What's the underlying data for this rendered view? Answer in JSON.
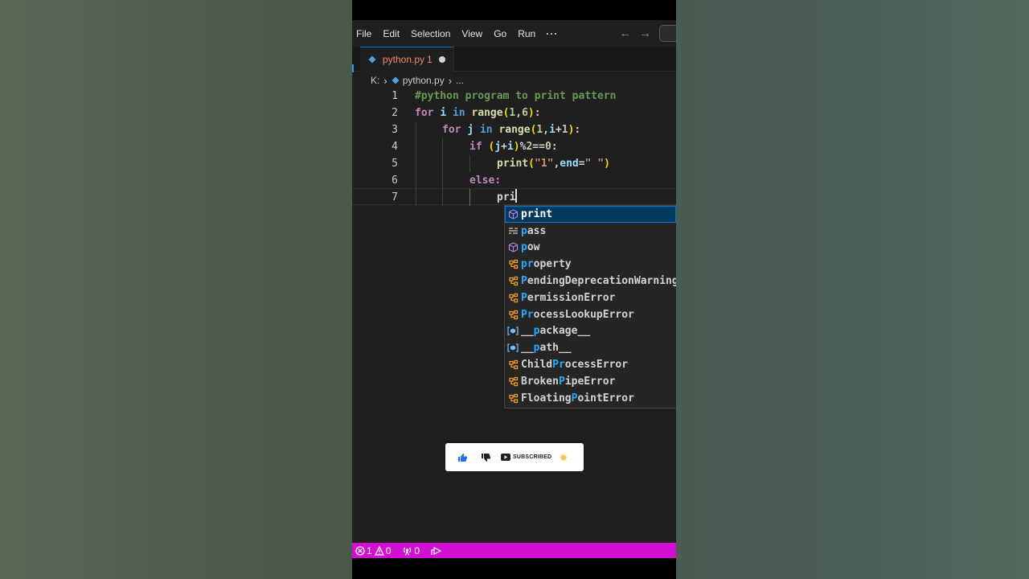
{
  "menubar": {
    "items": [
      "File",
      "Edit",
      "Selection",
      "View",
      "Go",
      "Run"
    ],
    "more": "···",
    "back_icon": "arrow-left-icon",
    "forward_icon": "arrow-right-icon"
  },
  "tab": {
    "filename": "python.py",
    "problem_count": "1",
    "modified": true
  },
  "breadcrumb": {
    "drive": "K:",
    "file": "python.py",
    "more": "..."
  },
  "editor": {
    "lines": [
      {
        "num": "1",
        "text": "#python program to print pattern"
      },
      {
        "num": "2",
        "text": "for i in range(1,6):"
      },
      {
        "num": "3",
        "text": "for j in range(1,i+1):"
      },
      {
        "num": "4",
        "text": "if (j+i)%2==0:"
      },
      {
        "num": "5",
        "text": "print(\"1\",end=\" \")"
      },
      {
        "num": "6",
        "text": "else:"
      },
      {
        "num": "7",
        "text": "pri"
      }
    ],
    "current_line": "7"
  },
  "suggestions": [
    {
      "label": "print",
      "icon": "cube-icon"
    },
    {
      "label": "pass",
      "icon": "keyword-icon"
    },
    {
      "label": "pow",
      "icon": "cube-icon"
    },
    {
      "label": "property",
      "icon": "class-icon"
    },
    {
      "label": "PendingDeprecationWarning",
      "icon": "class-icon"
    },
    {
      "label": "PermissionError",
      "icon": "class-icon"
    },
    {
      "label": "ProcessLookupError",
      "icon": "class-icon"
    },
    {
      "label": "__package__",
      "icon": "variable-icon"
    },
    {
      "label": "__path__",
      "icon": "variable-icon"
    },
    {
      "label": "ChildProcessError",
      "icon": "class-icon"
    },
    {
      "label": "BrokenPipeError",
      "icon": "class-icon"
    },
    {
      "label": "FloatingPointError",
      "icon": "class-icon"
    }
  ],
  "overlay": {
    "subscribed_label": "SUBSCRIBED"
  },
  "statusbar": {
    "errors": "1",
    "warnings": "0",
    "ports": "0"
  },
  "colors": {
    "statusbar": "#d30fd3",
    "editor_bg": "#1f1f1f",
    "suggest_selected": "#04395e",
    "keyword": "#569cd6",
    "control_keyword": "#c586c0",
    "function": "#dcdcaa",
    "comment": "#6a9955",
    "string": "#ce9178",
    "number": "#b5cea8",
    "match_highlight": "#2aaaff"
  }
}
